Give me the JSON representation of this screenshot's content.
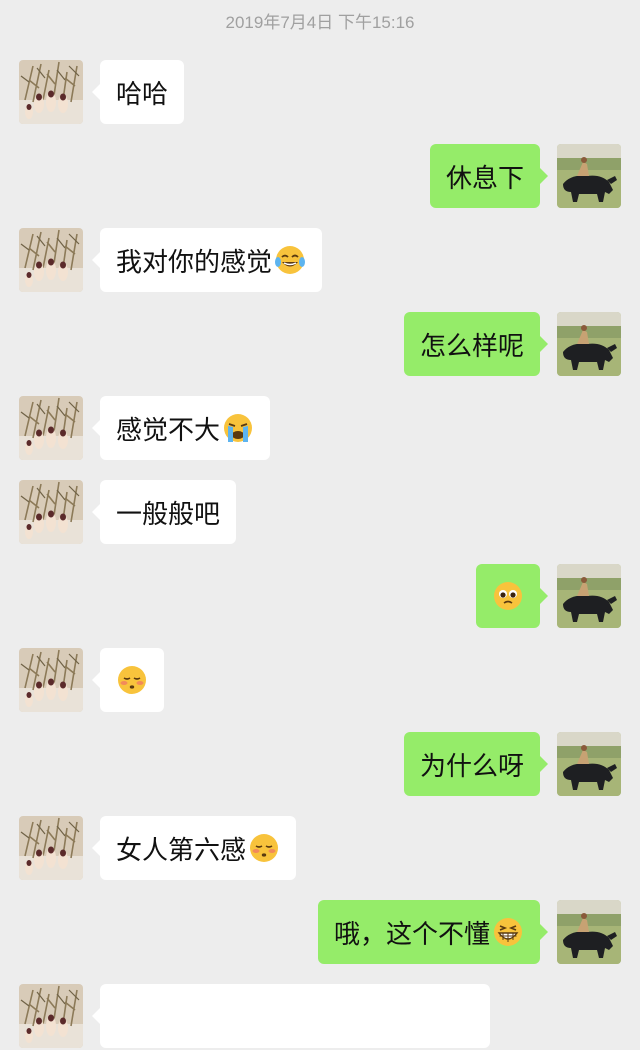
{
  "chat": {
    "timestamp": "2019年7月4日 下午15:16",
    "messages": [
      {
        "side": "left",
        "text": "哈哈",
        "emoji": null
      },
      {
        "side": "right",
        "text": "休息下",
        "emoji": null
      },
      {
        "side": "left",
        "text": "我对你的感觉",
        "emoji": "tears-of-joy-emoji"
      },
      {
        "side": "right",
        "text": "怎么样呢",
        "emoji": null
      },
      {
        "side": "left",
        "text": "感觉不大",
        "emoji": "loudly-crying-emoji"
      },
      {
        "side": "left",
        "text": "一般般吧",
        "emoji": null
      },
      {
        "side": "right",
        "text": "",
        "emoji": "pleading-face-emoji"
      },
      {
        "side": "left",
        "text": "",
        "emoji": "blushing-relieved-emoji"
      },
      {
        "side": "right",
        "text": "为什么呀",
        "emoji": null
      },
      {
        "side": "left",
        "text": "女人第六感",
        "emoji": "blushing-relieved-emoji"
      },
      {
        "side": "right",
        "text": "哦，这个不懂",
        "emoji": "grinning-squinting-emoji"
      }
    ]
  },
  "colors": {
    "background": "#ededed",
    "incoming_bubble": "#ffffff",
    "outgoing_bubble": "#95ec69",
    "timestamp_text": "#a0a0a0"
  },
  "icons": {
    "contact_avatar": "flowers-hand-avatar",
    "self_avatar": "buffalo-field-avatar"
  }
}
